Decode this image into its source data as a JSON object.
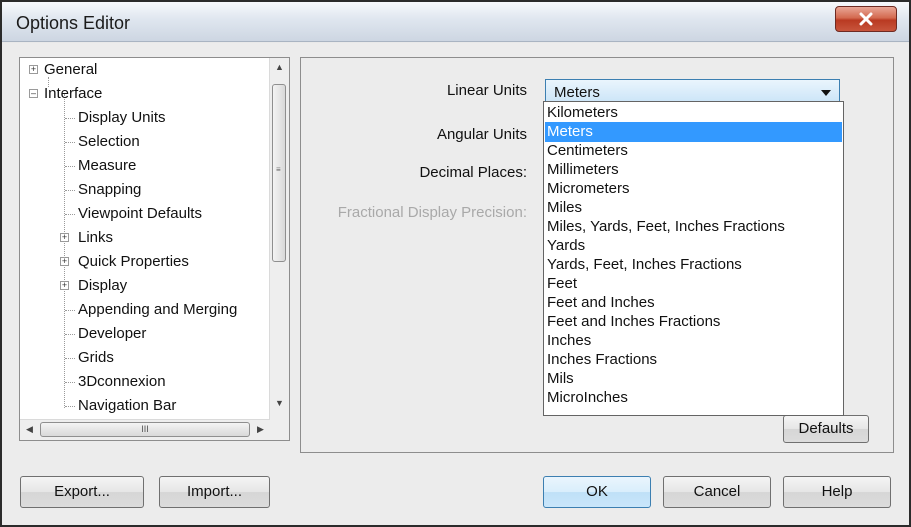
{
  "window": {
    "title": "Options Editor"
  },
  "tree": {
    "items": [
      {
        "label": "General"
      },
      {
        "label": "Interface"
      },
      {
        "label": "Display Units"
      },
      {
        "label": "Selection"
      },
      {
        "label": "Measure"
      },
      {
        "label": "Snapping"
      },
      {
        "label": "Viewpoint Defaults"
      },
      {
        "label": "Links"
      },
      {
        "label": "Quick Properties"
      },
      {
        "label": "Display"
      },
      {
        "label": "Appending and Merging"
      },
      {
        "label": "Developer"
      },
      {
        "label": "Grids"
      },
      {
        "label": "3Dconnexion"
      },
      {
        "label": "Navigation Bar"
      }
    ]
  },
  "settings": {
    "linear_units_label": "Linear Units",
    "linear_units_value": "Meters",
    "angular_units_label": "Angular Units",
    "decimal_places_label": "Decimal Places:",
    "fractional_precision_label": "Fractional Display Precision:"
  },
  "dropdown": {
    "options": [
      "Kilometers",
      "Meters",
      "Centimeters",
      "Millimeters",
      "Micrometers",
      "Miles",
      "Miles, Yards, Feet, Inches Fractions",
      "Yards",
      "Yards, Feet, Inches Fractions",
      "Feet",
      "Feet and Inches",
      "Feet and Inches Fractions",
      "Inches",
      "Inches Fractions",
      "Mils",
      "MicroInches"
    ],
    "selected": "Meters"
  },
  "buttons": {
    "defaults": "Defaults",
    "export": "Export...",
    "import": "Import...",
    "ok": "OK",
    "cancel": "Cancel",
    "help": "Help"
  },
  "scroll": {
    "h_thumb_grip": "III"
  },
  "icons": [
    "close-icon",
    "expand-icon",
    "collapse-icon",
    "dropdown-arrow-icon",
    "scroll-up-icon",
    "scroll-down-icon",
    "scroll-left-icon",
    "scroll-right-icon"
  ],
  "colors": {
    "selection": "#3399ff",
    "close_button": "#c8553c"
  }
}
